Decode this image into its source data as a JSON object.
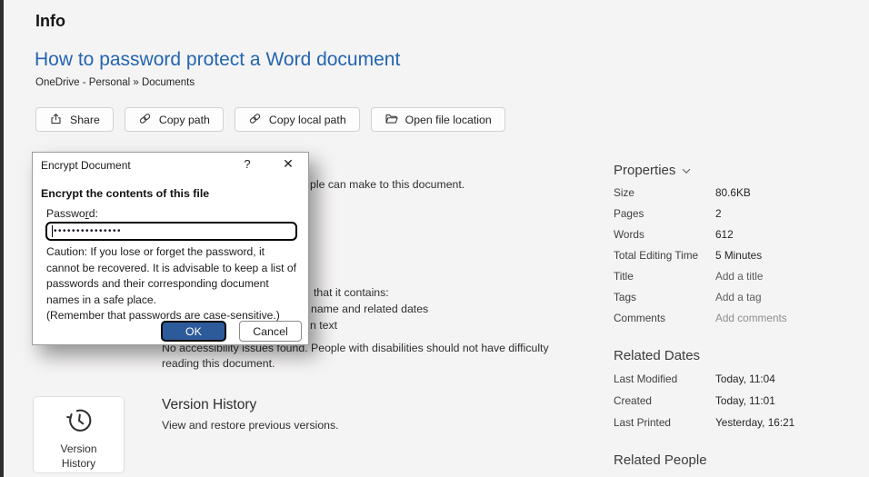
{
  "page": {
    "title": "Info"
  },
  "doc": {
    "title": "How to password protect a Word document",
    "breadcrumb": "OneDrive - Personal » Documents"
  },
  "toolbar": {
    "share": "Share",
    "copy_path": "Copy path",
    "copy_local_path": "Copy local path",
    "open_file_location": "Open file location"
  },
  "dialog": {
    "title": "Encrypt Document",
    "help_glyph": "?",
    "close_glyph": "✕",
    "heading": "Encrypt the contents of this file",
    "password_label_pre": "Passwo",
    "password_label_accel": "r",
    "password_label_post": "d:",
    "password_masked": "•••••••••••••••",
    "caution": "Caution: If you lose or forget the password, it\ncannot be recovered. It is advisable to keep a list of\npasswords and their corresponding document\nnames in a safe place.\n(Remember that passwords are case-sensitive.)",
    "ok_label": "OK",
    "cancel_label": "Cancel"
  },
  "background_fragments": {
    "protect": "ple can make to this document.",
    "inspect_intro": "that it contains:",
    "inspect_item1": "name and related dates",
    "inspect_item2": "n text",
    "accessibility_line1": "No accessibility issues found. People with disabilities should not have difficulty",
    "accessibility_line2": "reading this document."
  },
  "version_history": {
    "card_line1": "Version",
    "card_line2": "History",
    "title": "Version History",
    "subtitle": "View and restore previous versions."
  },
  "properties": {
    "title": "Properties",
    "rows": [
      {
        "label": "Size",
        "value": "80.6KB"
      },
      {
        "label": "Pages",
        "value": "2"
      },
      {
        "label": "Words",
        "value": "612"
      },
      {
        "label": "Total Editing Time",
        "value": "5 Minutes"
      },
      {
        "label": "Title",
        "value": "Add a title"
      },
      {
        "label": "Tags",
        "value": "Add a tag"
      },
      {
        "label": "Comments",
        "value": "Add comments"
      }
    ]
  },
  "related_dates": {
    "title": "Related Dates",
    "rows": [
      {
        "label": "Last Modified",
        "value": "Today, 11:04"
      },
      {
        "label": "Created",
        "value": "Today, 11:01"
      },
      {
        "label": "Last Printed",
        "value": "Yesterday, 16:21"
      }
    ]
  },
  "related_people": {
    "title": "Related People"
  },
  "colors": {
    "accent_blue": "#2d5b9a",
    "title_blue": "#2365b0",
    "background": "#f5f4f4"
  }
}
